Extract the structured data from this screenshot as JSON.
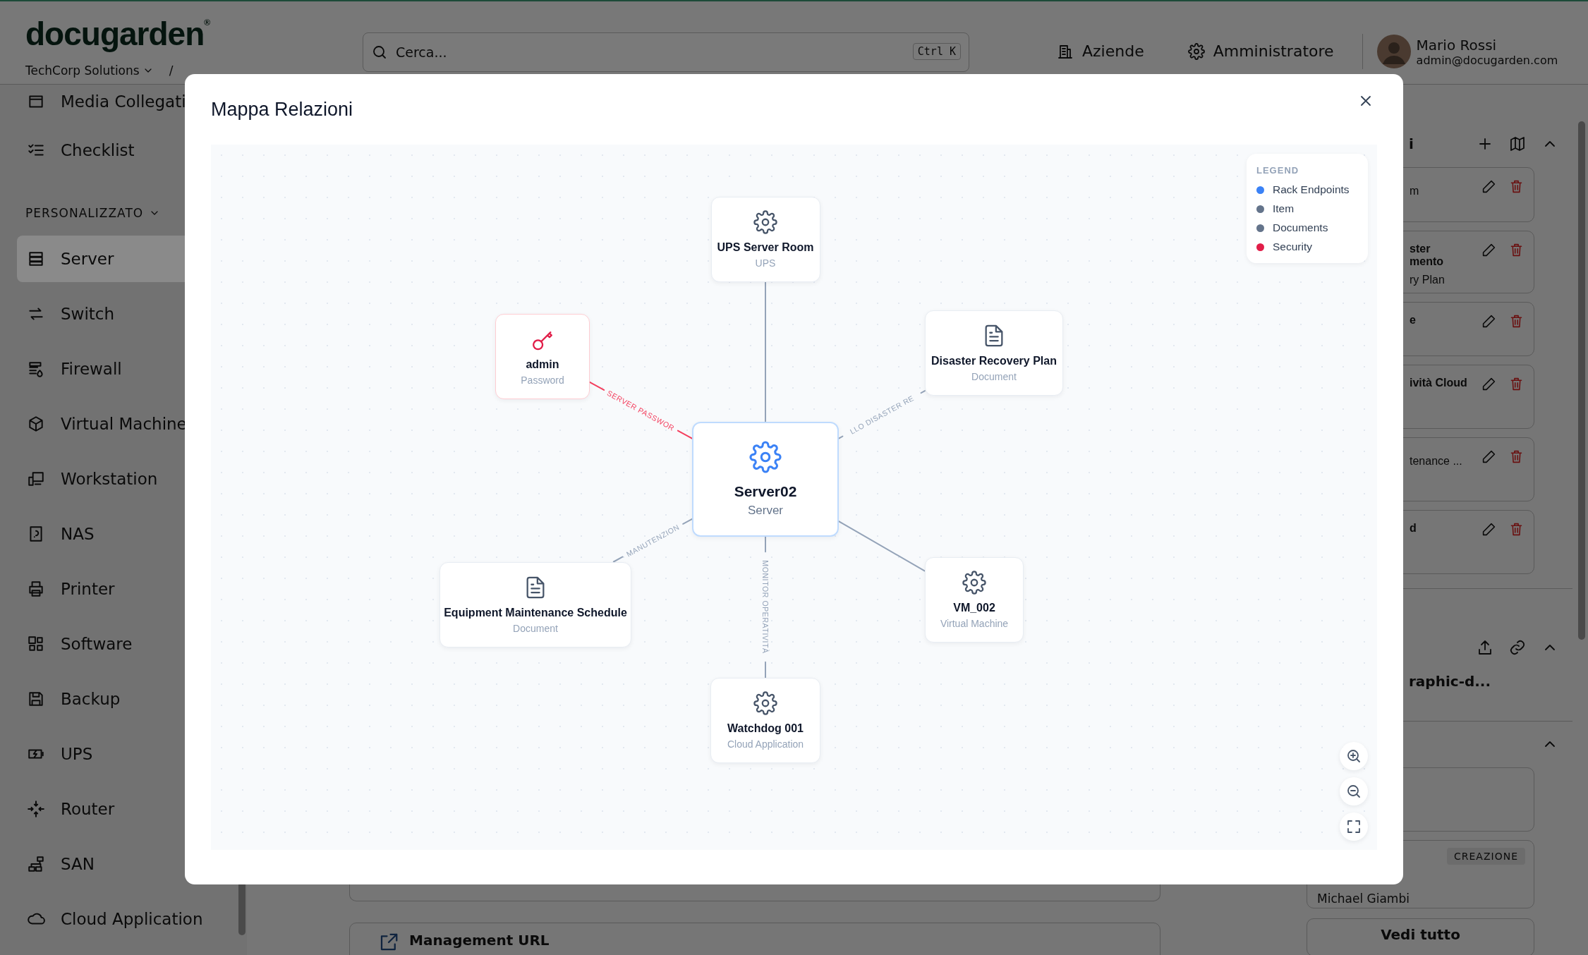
{
  "header": {
    "logo": "docugarden",
    "logo_mark": "®",
    "breadcrumb": [
      "TechCorp Solutions",
      "/"
    ],
    "search": {
      "placeholder": "Cerca...",
      "shortcut": "Ctrl K"
    },
    "nav": [
      "Aziende",
      "Amministratore"
    ],
    "user": {
      "name": "Mario Rossi",
      "email": "admin@docugarden.com"
    }
  },
  "sidebar": {
    "items": [
      {
        "label": "Media Collegati",
        "selected": false
      },
      {
        "label": "Checklist",
        "selected": false
      }
    ],
    "section": {
      "title": "PERSONALIZZATO",
      "items": [
        {
          "label": "Server",
          "selected": true
        },
        {
          "label": "Switch",
          "selected": false
        },
        {
          "label": "Firewall",
          "selected": false
        },
        {
          "label": "Virtual Machine",
          "selected": false
        },
        {
          "label": "Workstation",
          "selected": false
        },
        {
          "label": "NAS",
          "selected": false
        },
        {
          "label": "Printer",
          "selected": false
        },
        {
          "label": "Software",
          "selected": false
        },
        {
          "label": "Backup",
          "selected": false
        },
        {
          "label": "UPS",
          "selected": false
        },
        {
          "label": "Router",
          "selected": false
        },
        {
          "label": "SAN",
          "selected": false
        },
        {
          "label": "Cloud Application",
          "selected": false
        }
      ]
    }
  },
  "main": {
    "link_card": {
      "title": "Management URL"
    }
  },
  "right_panel": {
    "relations": {
      "title": "i",
      "cards": [
        {
          "subtitle": "m"
        },
        {
          "title": [
            "ster",
            "mento"
          ],
          "subtitle": "ry Plan"
        },
        {
          "title": [
            "e"
          ]
        },
        {
          "title": [
            "ività Cloud"
          ]
        },
        {
          "subtitle": "tenance ..."
        },
        {
          "title": [
            "d"
          ]
        }
      ]
    },
    "files": {
      "file": "raphic-d..."
    },
    "history": {
      "badge": "CREAZIONE",
      "author": "Michael Giambi",
      "button": "Vedi tutto"
    }
  },
  "modal": {
    "title": "Mappa Relazioni",
    "nodes": [
      {
        "kind": "item",
        "name": "UPS Server Room",
        "type": "UPS"
      },
      {
        "kind": "security",
        "name": "admin",
        "type": "Password",
        "edge_label": "SERVER PASSWOR"
      },
      {
        "kind": "document",
        "name": "Disaster Recovery Plan",
        "type": "Document",
        "edge_label": "LLO DISASTER RE"
      },
      {
        "kind": "endpoint",
        "name": "Server02",
        "type": "Server"
      },
      {
        "kind": "document",
        "name": "Equipment Maintenance Schedule",
        "type": "Document",
        "edge_label": "MANUTENZION"
      },
      {
        "kind": "item",
        "name": "VM_002",
        "type": "Virtual Machine"
      },
      {
        "kind": "item",
        "name": "Watchdog 001",
        "type": "Cloud Application",
        "edge_label": "MONITOR OPERATIVITÀ"
      }
    ],
    "legend": {
      "title": "LEGEND",
      "items": [
        {
          "label": "Rack Endpoints",
          "color": "#3b82f6"
        },
        {
          "label": "Item",
          "color": "#64748b"
        },
        {
          "label": "Documents",
          "color": "#64748b"
        },
        {
          "label": "Security",
          "color": "#e11d48"
        }
      ]
    }
  }
}
